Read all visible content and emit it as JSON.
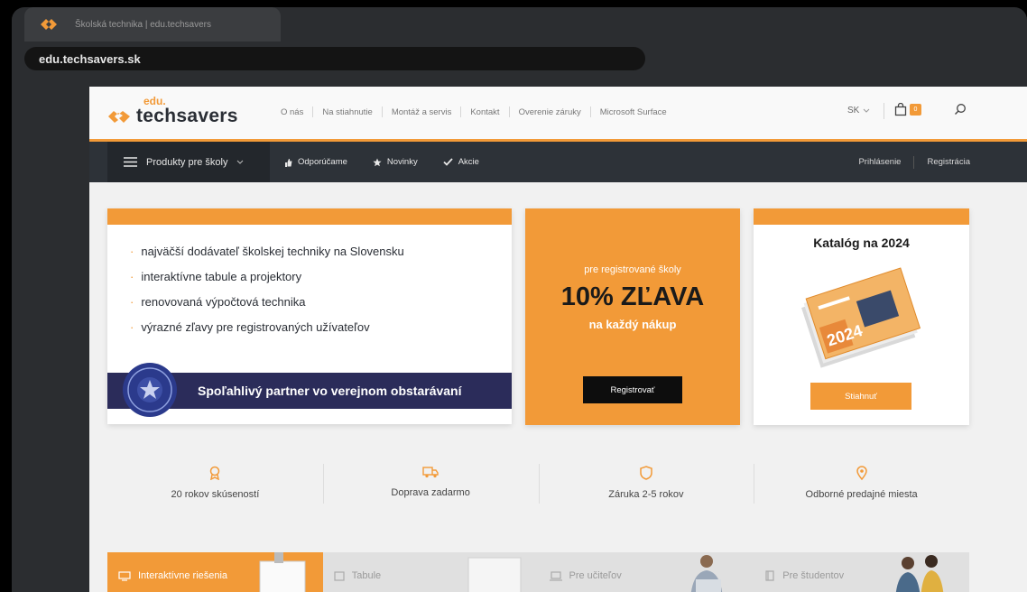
{
  "browser": {
    "tab_title": "Školská technika | edu.techsavers",
    "url": "edu.techsavers.sk"
  },
  "header": {
    "logo_prefix": "edu.",
    "logo_name": "techsavers",
    "nav": [
      "O nás",
      "Na stiahnutie",
      "Montáž a servis",
      "Kontakt",
      "Overenie záruky",
      "Microsoft Surface"
    ],
    "lang": "SK",
    "cart_count": "0"
  },
  "navbar": {
    "products": "Produkty pre školy",
    "links": [
      "Odporúčame",
      "Novinky",
      "Akcie"
    ],
    "login": "Prihlásenie",
    "register": "Registrácia"
  },
  "promo_left": {
    "bullets": [
      "najväčší dodávateľ školskej techniky na Slovensku",
      "interaktívne tabule a projektory",
      "renovovaná výpočtová technika",
      "výrazné zľavy pre registrovaných užívateľov"
    ],
    "partner": "Spoľahlivý partner vo verejnom obstarávaní"
  },
  "promo_mid": {
    "pre": "pre registrované školy",
    "big": "10% ZĽAVA",
    "sub": "na každý nákup",
    "button": "Registrovať"
  },
  "promo_right": {
    "title": "Katalóg na 2024",
    "button": "Stiahnuť"
  },
  "features": [
    {
      "label": "20 rokov skúseností",
      "icon": "award-icon"
    },
    {
      "label": "Doprava zadarmo",
      "icon": "truck-icon"
    },
    {
      "label": "Záruka 2-5 rokov",
      "icon": "shield-icon"
    },
    {
      "label": "Odborné predajné miesta",
      "icon": "map-pin-icon"
    }
  ],
  "categories": [
    {
      "label": "Interaktívne riešenia"
    },
    {
      "label": "Tabule"
    },
    {
      "label": "Pre učiteľov"
    },
    {
      "label": "Pre študentov"
    }
  ],
  "colors": {
    "accent": "#f29a38",
    "dark": "#2d3238",
    "navy": "#2b2c5a"
  }
}
